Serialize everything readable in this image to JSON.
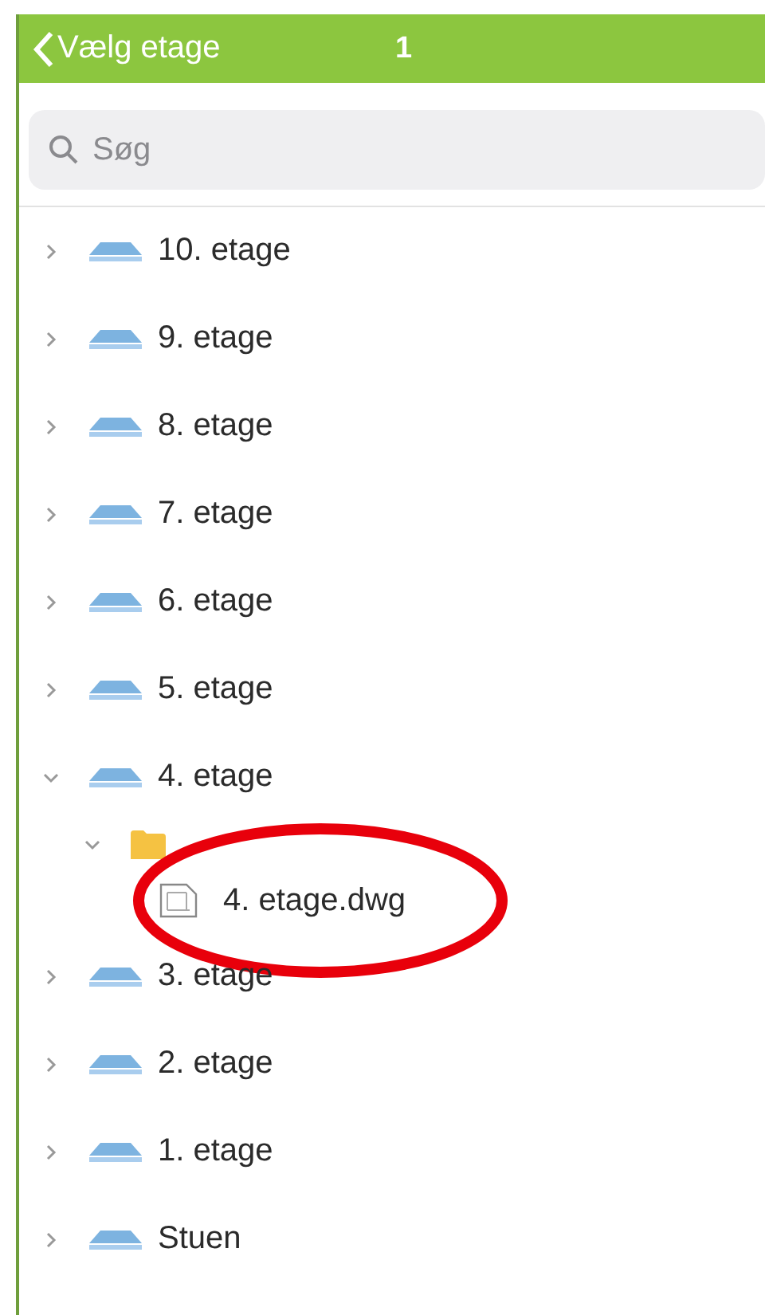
{
  "header": {
    "back_label": "Vælg etage",
    "count": "1"
  },
  "search": {
    "placeholder": "Søg"
  },
  "tree": [
    {
      "kind": "floor",
      "label": "10. etage",
      "expanded": false
    },
    {
      "kind": "floor",
      "label": "9. etage",
      "expanded": false
    },
    {
      "kind": "floor",
      "label": "8. etage",
      "expanded": false
    },
    {
      "kind": "floor",
      "label": "7. etage",
      "expanded": false
    },
    {
      "kind": "floor",
      "label": "6. etage",
      "expanded": false
    },
    {
      "kind": "floor",
      "label": "5. etage",
      "expanded": false
    },
    {
      "kind": "floor",
      "label": "4. etage",
      "expanded": true,
      "children": [
        {
          "kind": "folder",
          "expanded": true,
          "children": [
            {
              "kind": "file",
              "label": "4. etage.dwg",
              "highlighted": true
            }
          ]
        }
      ]
    },
    {
      "kind": "floor",
      "label": "3. etage",
      "expanded": false
    },
    {
      "kind": "floor",
      "label": "2. etage",
      "expanded": false
    },
    {
      "kind": "floor",
      "label": "1. etage",
      "expanded": false
    },
    {
      "kind": "floor",
      "label": "Stuen",
      "expanded": false
    }
  ]
}
